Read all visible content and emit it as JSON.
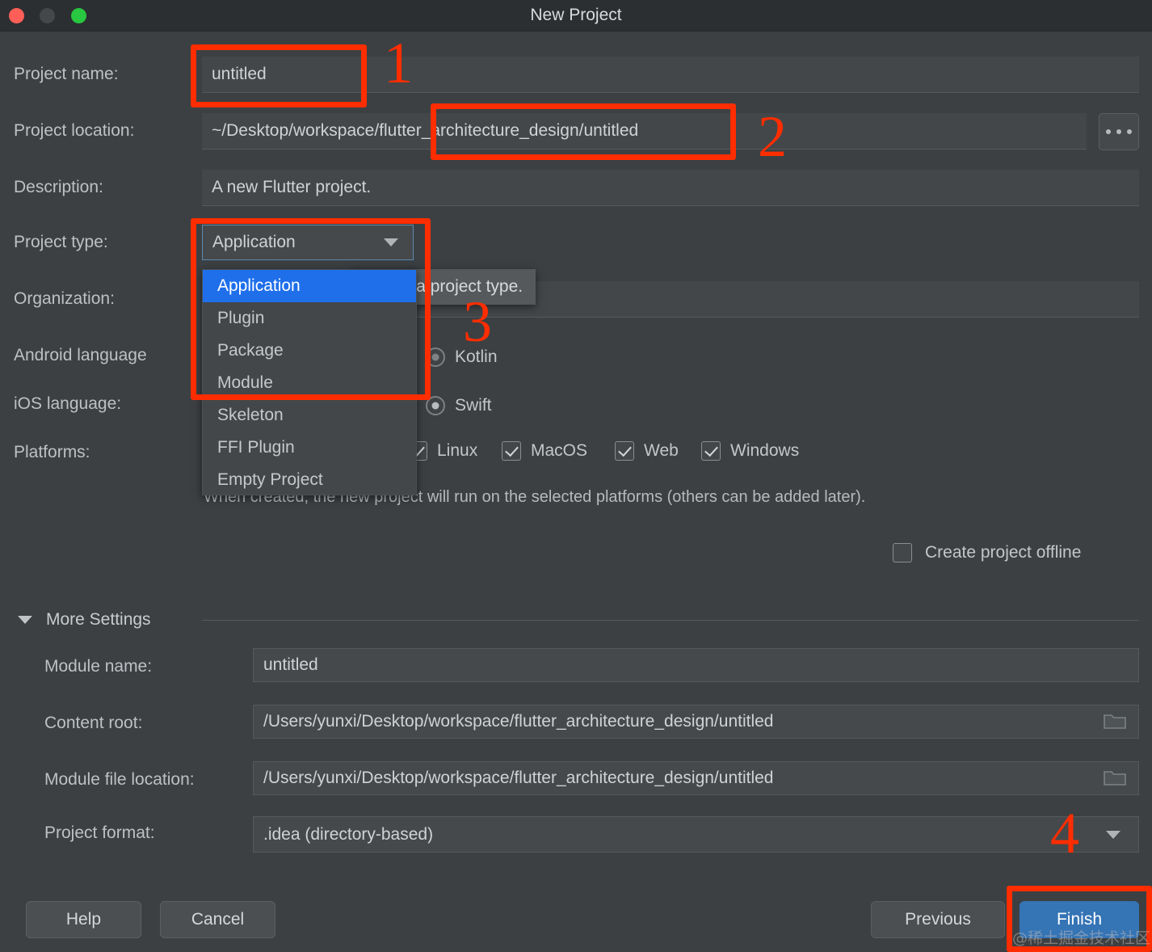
{
  "window": {
    "title": "New Project",
    "controls": [
      "close-button",
      "minimize-button",
      "zoom-button"
    ]
  },
  "form": {
    "project_name": {
      "label": "Project name:",
      "value": "untitled"
    },
    "project_location": {
      "label": "Project location:",
      "value": "~/Desktop/workspace/flutter_architecture_design/untitled",
      "browse_label": "..."
    },
    "description": {
      "label": "Description:",
      "value": "A new Flutter project."
    },
    "project_type": {
      "label": "Project type:",
      "value": "Application",
      "tooltip": "Select a project type.",
      "options": [
        "Application",
        "Plugin",
        "Package",
        "Module",
        "Skeleton",
        "FFI Plugin",
        "Empty Project"
      ],
      "selected_index": 0
    },
    "organization": {
      "label": "Organization:",
      "value": ""
    },
    "android_language": {
      "label": "Android language",
      "options": [
        {
          "label": "Kotlin",
          "checked": true
        }
      ]
    },
    "ios_language": {
      "label": "iOS language:",
      "options": [
        {
          "label": "Swift",
          "checked": true
        }
      ]
    },
    "platforms": {
      "label": "Platforms:",
      "items": [
        {
          "label": "Linux",
          "checked": true
        },
        {
          "label": "MacOS",
          "checked": true
        },
        {
          "label": "Web",
          "checked": true
        },
        {
          "label": "Windows",
          "checked": true
        }
      ],
      "note": "When created, the new project will run on the selected platforms (others can be added later)."
    },
    "create_offline": {
      "label": "Create project offline",
      "checked": false
    }
  },
  "more_settings": {
    "title": "More Settings",
    "expanded": true,
    "module_name": {
      "label": "Module name:",
      "value": "untitled"
    },
    "content_root": {
      "label": "Content root:",
      "value": "/Users/yunxi/Desktop/workspace/flutter_architecture_design/untitled"
    },
    "module_file_location": {
      "label": "Module file location:",
      "value": "/Users/yunxi/Desktop/workspace/flutter_architecture_design/untitled"
    },
    "project_format": {
      "label": "Project format:",
      "value": ".idea (directory-based)"
    }
  },
  "footer": {
    "help": "Help",
    "cancel": "Cancel",
    "previous": "Previous",
    "finish": "Finish"
  },
  "annotations": {
    "numbers": [
      "1",
      "2",
      "3",
      "4"
    ],
    "color": "#ff2d00"
  },
  "watermark": "@稀土掘金技术社区"
}
